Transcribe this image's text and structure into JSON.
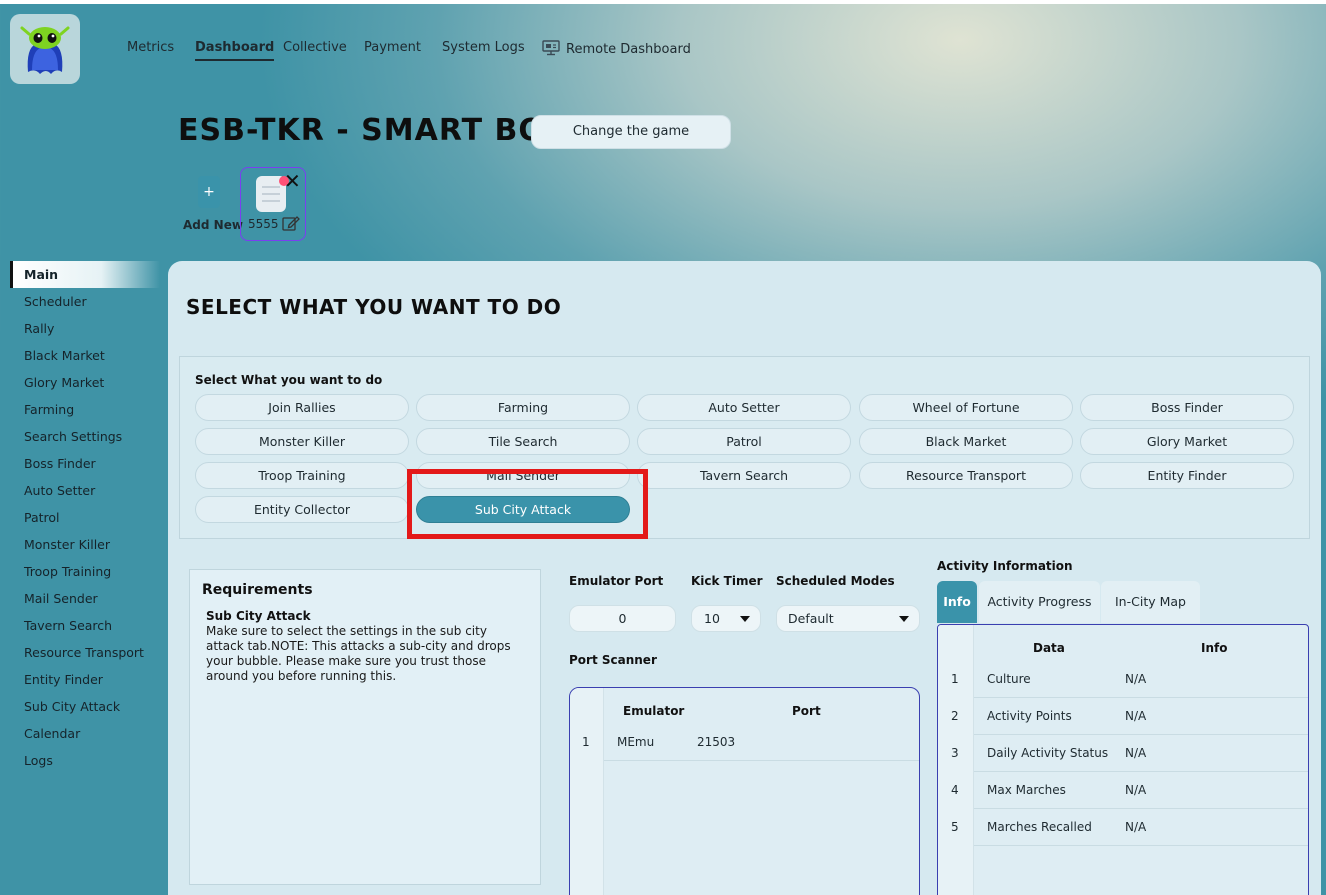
{
  "nav": {
    "items": [
      "Metrics",
      "Dashboard",
      "Collective",
      "Payment",
      "System Logs"
    ],
    "remote": "Remote Dashboard",
    "active": "Dashboard"
  },
  "header": {
    "title": "ESB-TKR - SMART BOT",
    "change_game": "Change the game",
    "add_new": "Add New",
    "profile_name": "5555"
  },
  "sidebar": {
    "items": [
      "Main",
      "Scheduler",
      "Rally",
      "Black Market",
      "Glory Market",
      "Farming",
      "Search Settings",
      "Boss Finder",
      "Auto Setter",
      "Patrol",
      "Monster Killer",
      "Troop Training",
      "Mail Sender",
      "Tavern Search",
      "Resource Transport",
      "Entity Finder",
      "Sub City Attack",
      "Calendar",
      "Logs"
    ],
    "active": "Main"
  },
  "main": {
    "title": "SELECT WHAT YOU WANT TO DO",
    "select_label": "Select What you want to do",
    "options": [
      "Join Rallies",
      "Farming",
      "Auto Setter",
      "Wheel of Fortune",
      "Boss Finder",
      "Monster Killer",
      "Tile Search",
      "Patrol",
      "Black Market",
      "Glory Market",
      "Troop Training",
      "Mail Sender",
      "Tavern Search",
      "Resource Transport",
      "Entity Finder",
      "Entity Collector",
      "Sub City Attack"
    ],
    "selected": "Sub City Attack"
  },
  "requirements": {
    "title": "Requirements",
    "subtitle": "Sub City Attack",
    "text": "Make sure to select the settings in the sub city attack tab.NOTE: This attacks a sub-city and drops your bubble. Please make sure you trust those around you before running this."
  },
  "settings": {
    "emulator_port_label": "Emulator Port",
    "emulator_port_value": "0",
    "kick_timer_label": "Kick Timer",
    "kick_timer_value": "10",
    "scheduled_modes_label": "Scheduled Modes",
    "scheduled_modes_value": "Default"
  },
  "port_scanner": {
    "title": "Port Scanner",
    "columns": [
      "Emulator",
      "Port"
    ],
    "rows": [
      {
        "index": "1",
        "emulator": "MEmu",
        "port": "21503"
      }
    ]
  },
  "activity": {
    "title": "Activity Information",
    "tabs": [
      "Info",
      "Activity Progress",
      "In-City Map"
    ],
    "active_tab": "Info",
    "columns": [
      "Data",
      "Info"
    ],
    "rows": [
      {
        "index": "1",
        "data": "Culture",
        "info": "N/A"
      },
      {
        "index": "2",
        "data": "Activity Points",
        "info": "N/A"
      },
      {
        "index": "3",
        "data": "Daily Activity Status",
        "info": "N/A"
      },
      {
        "index": "4",
        "data": "Max Marches",
        "info": "N/A"
      },
      {
        "index": "5",
        "data": "Marches Recalled",
        "info": "N/A"
      }
    ]
  }
}
